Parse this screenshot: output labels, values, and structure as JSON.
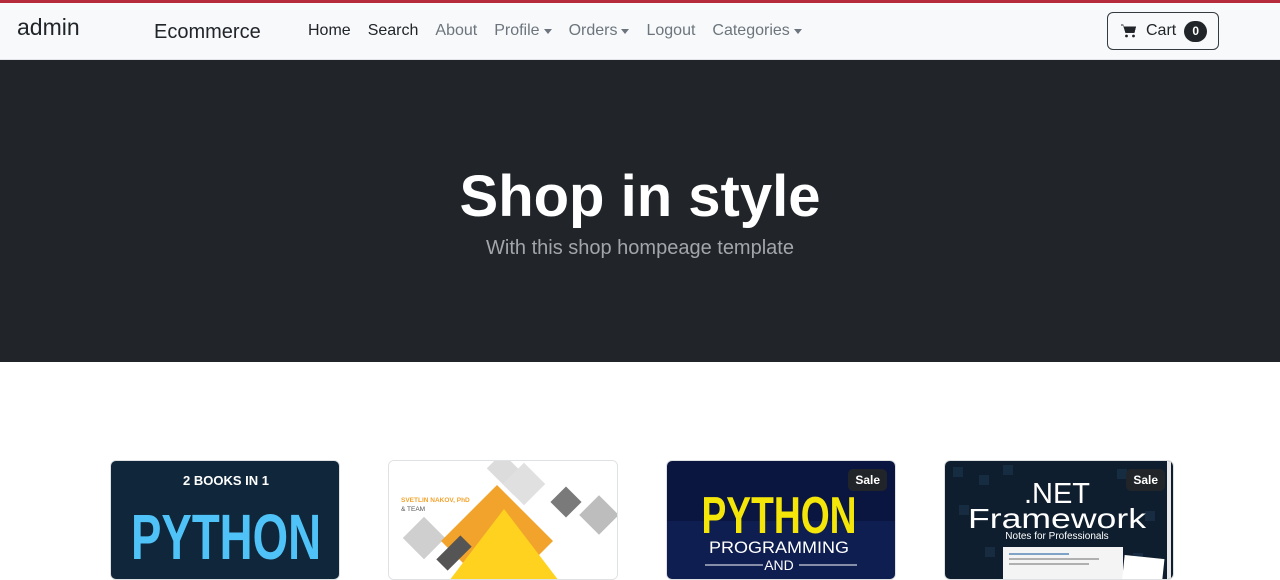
{
  "navbar": {
    "brand_user": "admin",
    "brand_name": "Ecommerce",
    "links": [
      {
        "label": "Home",
        "active": true,
        "dropdown": false
      },
      {
        "label": "Search",
        "active": true,
        "dropdown": false
      },
      {
        "label": "About",
        "active": false,
        "dropdown": false
      },
      {
        "label": "Profile",
        "active": false,
        "dropdown": true
      },
      {
        "label": "Orders",
        "active": false,
        "dropdown": true
      },
      {
        "label": "Logout",
        "active": false,
        "dropdown": false
      },
      {
        "label": "Categories",
        "active": false,
        "dropdown": true
      }
    ],
    "cart": {
      "label": "Cart",
      "count": "0",
      "icon": "cart-icon"
    }
  },
  "hero": {
    "title": "Shop in style",
    "subtitle": "With this shop hompeage template"
  },
  "products": [
    {
      "cover_lines": [
        "2 BOOKS IN 1",
        "PYTHON"
      ],
      "badge": ""
    },
    {
      "cover_lines": [
        "SVETLIN NAKOV, PhD",
        "& TEAM"
      ],
      "badge": ""
    },
    {
      "cover_lines": [
        "PYTHON",
        "PROGRAMMING",
        "AND"
      ],
      "badge": "Sale"
    },
    {
      "cover_lines": [
        ".NET",
        "Framework",
        "Notes for Professionals"
      ],
      "badge": "Sale"
    }
  ],
  "colors": {
    "accent_topline": "#b52b3b",
    "navbar_bg": "#f8f9fa",
    "hero_bg": "#212529",
    "badge_bg": "#212529"
  }
}
